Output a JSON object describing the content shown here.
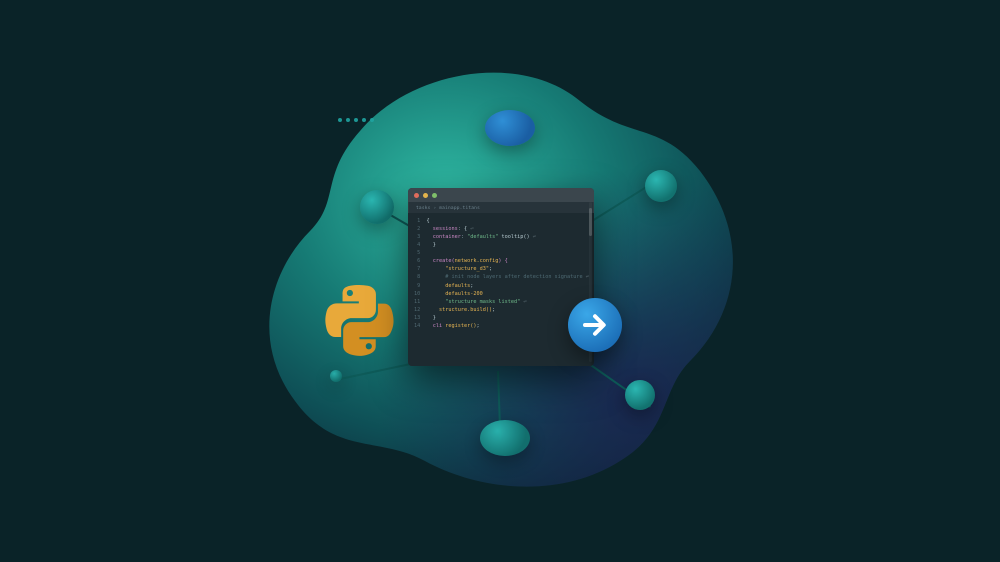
{
  "editor": {
    "breadcrumb": "tasks › mainapp.titans",
    "traffic_lights": [
      "close",
      "minimize",
      "zoom"
    ],
    "code_lines": [
      {
        "n": "1",
        "segs": [
          {
            "c": "tok-plain",
            "t": "{"
          }
        ]
      },
      {
        "n": "2",
        "segs": [
          {
            "c": "tok-op",
            "t": "  "
          },
          {
            "c": "tok-kw",
            "t": "sessions"
          },
          {
            "c": "tok-op",
            "t": ": "
          },
          {
            "c": "tok-plain",
            "t": "{"
          },
          {
            "c": "tok-soft",
            "t": " ⏎"
          }
        ]
      },
      {
        "n": "3",
        "segs": [
          {
            "c": "tok-op",
            "t": "  "
          },
          {
            "c": "tok-kw",
            "t": "container"
          },
          {
            "c": "tok-op",
            "t": ": "
          },
          {
            "c": "tok-str",
            "t": "\"defaults\""
          },
          {
            "c": "tok-plain",
            "t": " tooltip()"
          },
          {
            "c": "tok-soft",
            "t": " ⏎"
          }
        ]
      },
      {
        "n": "4",
        "segs": [
          {
            "c": "tok-plain",
            "t": "  }"
          }
        ]
      },
      {
        "n": "5",
        "segs": [
          {
            "c": "",
            "t": ""
          }
        ]
      },
      {
        "n": "6",
        "segs": [
          {
            "c": "tok-kw",
            "t": "  create("
          },
          {
            "c": "tok-fn",
            "t": "network.config"
          },
          {
            "c": "tok-kw",
            "t": ") {"
          }
        ]
      },
      {
        "n": "7",
        "segs": [
          {
            "c": "tok-op",
            "t": "      "
          },
          {
            "c": "tok-fn",
            "t": "\"structure_d3\""
          },
          {
            "c": "tok-plain",
            "t": ";"
          }
        ]
      },
      {
        "n": "8",
        "segs": [
          {
            "c": "tok-op",
            "t": "      "
          },
          {
            "c": "tok-comm",
            "t": "# init node layers after detection signature"
          },
          {
            "c": "tok-soft",
            "t": " ⏎"
          }
        ]
      },
      {
        "n": "9",
        "segs": [
          {
            "c": "tok-op",
            "t": "      "
          },
          {
            "c": "tok-fn",
            "t": "defaults"
          },
          {
            "c": "tok-plain",
            "t": ";"
          }
        ]
      },
      {
        "n": "10",
        "segs": [
          {
            "c": "tok-op",
            "t": "      "
          },
          {
            "c": "tok-fn",
            "t": "defaults-200"
          }
        ]
      },
      {
        "n": "11",
        "segs": [
          {
            "c": "tok-op",
            "t": "      "
          },
          {
            "c": "tok-str",
            "t": "\"structure masks listed\""
          },
          {
            "c": "tok-soft",
            "t": " ⏎"
          }
        ]
      },
      {
        "n": "12",
        "segs": [
          {
            "c": "tok-op",
            "t": "    "
          },
          {
            "c": "tok-fn",
            "t": "structure.build()"
          },
          {
            "c": "tok-plain",
            "t": ";"
          }
        ]
      },
      {
        "n": "13",
        "segs": [
          {
            "c": "tok-plain",
            "t": "  }"
          }
        ]
      },
      {
        "n": "14",
        "segs": [
          {
            "c": "tok-kw",
            "t": "  cli "
          },
          {
            "c": "tok-fn",
            "t": "register()"
          },
          {
            "c": "tok-plain",
            "t": ";"
          }
        ]
      }
    ]
  },
  "icons": {
    "python": "python-icon",
    "arrow": "arrow-right-icon"
  }
}
